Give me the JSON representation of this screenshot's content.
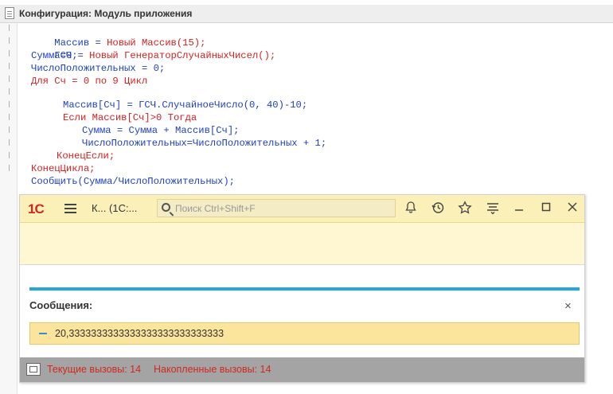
{
  "editor": {
    "title": "Конфигурация: Модуль приложения",
    "lines": [
      {
        "t": "Массив = ",
        "k": "Новый Массив(15);"
      },
      {
        "t": "ГСЧ = ",
        "k": "Новый ГенераторСлучайныхЧисел();"
      },
      {
        "t": "Сумма=0;",
        "k": ""
      },
      {
        "t": "ЧислоПоложительных = 0;",
        "k": ""
      },
      {
        "t": "Для Сч = 0 по 9 Цикл",
        "k": ""
      },
      {
        "t": "Массив[Сч] = ГСЧ.СлучайноеЧисло(0, 40)-10;",
        "k": ""
      },
      {
        "t": "Если Массив[Сч]>0 Тогда",
        "k": ""
      },
      {
        "t": "Сумма = Сумма + Массив[Сч];",
        "k": ""
      },
      {
        "t": "ЧислоПоложительных=ЧислоПоложительных + 1;",
        "k": ""
      },
      {
        "t": "КонецЕсли;",
        "k": ""
      },
      {
        "t": "КонецЦикла;",
        "k": ""
      },
      {
        "t": "Сообщить(Сумма/ЧислоПоложительных);",
        "k": ""
      }
    ]
  },
  "client": {
    "logo": "1С",
    "app_title": "К...  (1С:...",
    "search_placeholder": "Поиск Ctrl+Shift+F",
    "toolbar_icons": [
      "bell-icon",
      "history-icon",
      "star-icon",
      "settings-menu-icon",
      "minimize-icon",
      "maximize-icon",
      "close-icon"
    ],
    "messages_title": "Сообщения:",
    "close_glyph": "×",
    "message": "20,3333333333333333333333333333",
    "status_current": "Текущие вызовы: 14",
    "status_accumulated": "Накопленные вызовы: 14"
  },
  "colors": {
    "keyword": "#d32020",
    "identifier": "#1f3fbf",
    "brand": "#d0281e",
    "accent": "#26a6dc",
    "message_bg": "#fbe49b"
  }
}
